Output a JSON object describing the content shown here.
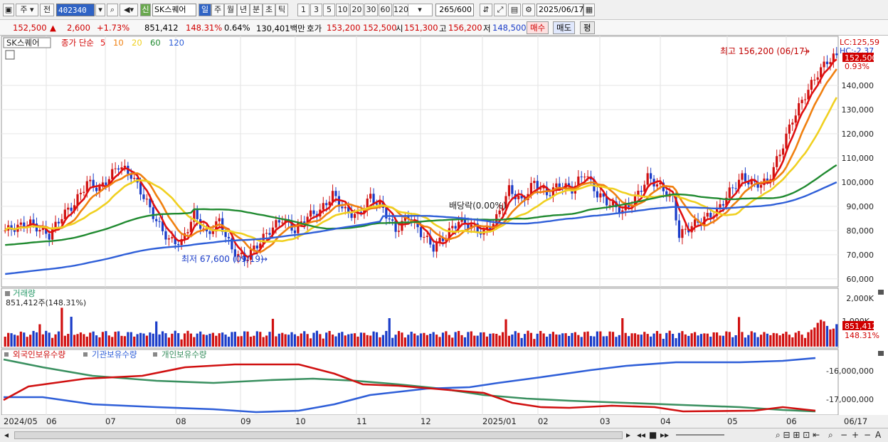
{
  "toolbar": {
    "market": "주",
    "mode": "전",
    "code": "402340",
    "stock_name": "SK스퀘어",
    "tag": "신",
    "periods": [
      "일",
      "주",
      "월",
      "년",
      "분",
      "초",
      "틱"
    ],
    "intervals": [
      "1",
      "3",
      "5",
      "10",
      "20",
      "30",
      "60",
      "120"
    ],
    "count": "265",
    "count_total": "/600",
    "date": "2025/06/17"
  },
  "quote": {
    "price": "152,500",
    "change": "2,600",
    "change_pct": "+1.73%",
    "volume": "851,412",
    "volume_pct": "148.31%",
    "turnover": "0.64%",
    "amount": "130,401백만",
    "ask_label": "호가",
    "ask1": "153,200",
    "ask2": "152,500",
    "open_label": "시",
    "open": "151,300",
    "high_label": "고",
    "high": "156,200",
    "low_label": "저",
    "low": "148,500",
    "buy": "매수",
    "sell": "매도",
    "avg": "평"
  },
  "legend": {
    "name": "SK스퀘어",
    "ma_label": "종가 단순",
    "ma": [
      "5",
      "10",
      "20",
      "60",
      "120"
    ],
    "ma_colors": [
      "#e01010",
      "#f08010",
      "#f0d020",
      "#208a30",
      "#2f5fd8"
    ]
  },
  "annotations": {
    "high": "최고 156,200 (06/17)",
    "low": "최저 67,600 (09/19)",
    "dividend": "배당락(0.00%)"
  },
  "axis_right": {
    "lc": "LC:125,59",
    "hc": "HC:-2.37",
    "last": "152,500",
    "last_pct": "0.93%",
    "price_ticks": [
      "140,000",
      "130,000",
      "120,000",
      "110,000",
      "100,000",
      "90,000",
      "80,000",
      "70,000",
      "60,000"
    ],
    "vol_ticks": [
      "2,000K",
      "1,000K"
    ],
    "vol_last": "851,412",
    "vol_pct": "148.31%",
    "flow_ticks": [
      "-16,000,000",
      "-17,000,000"
    ]
  },
  "volume_panel": {
    "title": "거래량",
    "value": "851,412주(148.31%)"
  },
  "flow_panel": {
    "series": [
      "외국인보유수량",
      "기관보유수량",
      "개인보유수량"
    ],
    "colors": [
      "#d01010",
      "#2f5fd8",
      "#3a9060"
    ]
  },
  "x_axis": [
    "2024/05",
    "06",
    "07",
    "08",
    "09",
    "10",
    "11",
    "12",
    "2025/01",
    "02",
    "03",
    "04",
    "05",
    "06",
    "06/17"
  ],
  "colors": {
    "up": "#d01010",
    "down": "#1a3cc8",
    "grid": "#e6e6e6"
  },
  "chart_data": {
    "type": "candlestick",
    "ylim": [
      57000,
      160000
    ],
    "price_path": [
      [
        0,
        80000
      ],
      [
        8,
        83000
      ],
      [
        14,
        78000
      ],
      [
        18,
        86000
      ],
      [
        22,
        91000
      ],
      [
        26,
        100000
      ],
      [
        30,
        97000
      ],
      [
        36,
        107000
      ],
      [
        40,
        103000
      ],
      [
        44,
        94000
      ],
      [
        48,
        84000
      ],
      [
        52,
        76000
      ],
      [
        56,
        75000
      ],
      [
        60,
        87000
      ],
      [
        64,
        78000
      ],
      [
        68,
        84000
      ],
      [
        72,
        72000
      ],
      [
        76,
        68000
      ],
      [
        80,
        74000
      ],
      [
        84,
        80000
      ],
      [
        88,
        85000
      ],
      [
        92,
        80000
      ],
      [
        96,
        86000
      ],
      [
        100,
        88000
      ],
      [
        104,
        95000
      ],
      [
        108,
        88000
      ],
      [
        112,
        86000
      ],
      [
        116,
        94000
      ],
      [
        120,
        89000
      ],
      [
        124,
        80000
      ],
      [
        128,
        86000
      ],
      [
        132,
        79000
      ],
      [
        136,
        73000
      ],
      [
        140,
        78000
      ],
      [
        144,
        84000
      ],
      [
        148,
        82000
      ],
      [
        152,
        79000
      ],
      [
        156,
        85000
      ],
      [
        160,
        97000
      ],
      [
        164,
        92000
      ],
      [
        168,
        100000
      ],
      [
        172,
        95000
      ],
      [
        176,
        99000
      ],
      [
        180,
        97000
      ],
      [
        184,
        104000
      ],
      [
        188,
        95000
      ],
      [
        192,
        91000
      ],
      [
        196,
        88000
      ],
      [
        200,
        93000
      ],
      [
        204,
        102000
      ],
      [
        208,
        98000
      ],
      [
        212,
        93000
      ],
      [
        214,
        78000
      ],
      [
        218,
        82000
      ],
      [
        222,
        85000
      ],
      [
        226,
        88000
      ],
      [
        230,
        96000
      ],
      [
        234,
        102000
      ],
      [
        238,
        99000
      ],
      [
        242,
        100000
      ],
      [
        246,
        112000
      ],
      [
        250,
        126000
      ],
      [
        254,
        136000
      ],
      [
        258,
        145000
      ],
      [
        261,
        150000
      ],
      [
        264,
        152500
      ]
    ]
  }
}
